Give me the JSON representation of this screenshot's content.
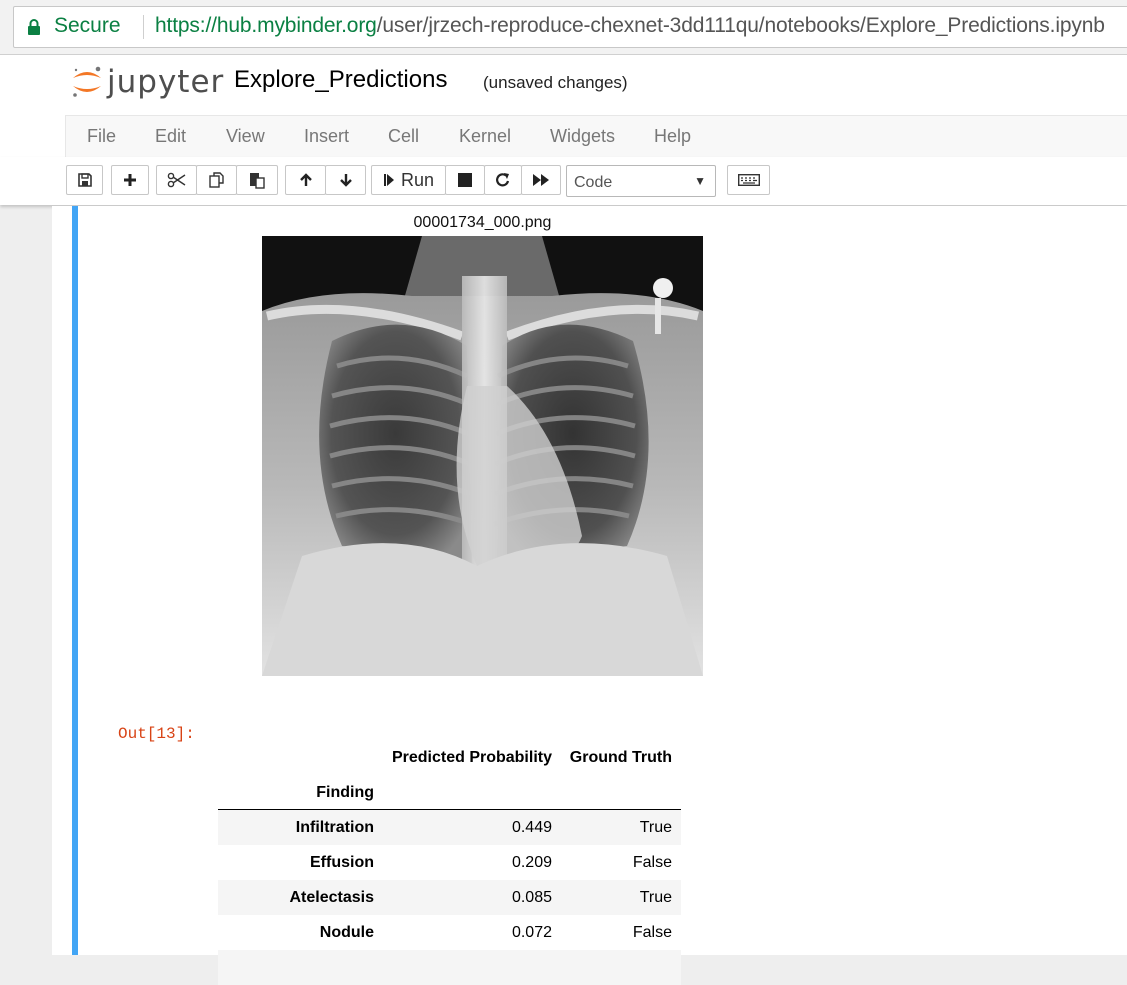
{
  "browser": {
    "secure_label": "Secure",
    "url_host": "https://hub.mybinder.org",
    "url_path": "/user/jrzech-reproduce-chexnet-3dd111qu/notebooks/Explore_Predictions.ipynb"
  },
  "header": {
    "logo_text": "jupyter",
    "notebook_name": "Explore_Predictions",
    "save_status": "(unsaved changes)"
  },
  "menu": [
    "File",
    "Edit",
    "View",
    "Insert",
    "Cell",
    "Kernel",
    "Widgets",
    "Help"
  ],
  "toolbar": {
    "run_label": "Run",
    "cell_type": "Code",
    "icons": [
      "save-icon",
      "plus-icon",
      "cut-icon",
      "copy-icon",
      "paste-icon",
      "arrow-up-icon",
      "arrow-down-icon",
      "step-forward-icon",
      "stop-icon",
      "restart-icon",
      "fast-forward-icon",
      "keyboard-icon"
    ]
  },
  "output": {
    "image_title": "00001734_000.png",
    "prompt": "Out[13]:",
    "table": {
      "columns": [
        "Predicted Probability",
        "Ground Truth"
      ],
      "index_name": "Finding",
      "rows": [
        {
          "finding": "Infiltration",
          "prob": "0.449",
          "truth": "True"
        },
        {
          "finding": "Effusion",
          "prob": "0.209",
          "truth": "False"
        },
        {
          "finding": "Atelectasis",
          "prob": "0.085",
          "truth": "True"
        },
        {
          "finding": "Nodule",
          "prob": "0.072",
          "truth": "False"
        }
      ]
    }
  },
  "colors": {
    "secure_green": "#0b8043",
    "cell_selected_bar": "#42a5f5",
    "out_prompt": "#d84315",
    "jupyter_orange": "#f37726"
  }
}
